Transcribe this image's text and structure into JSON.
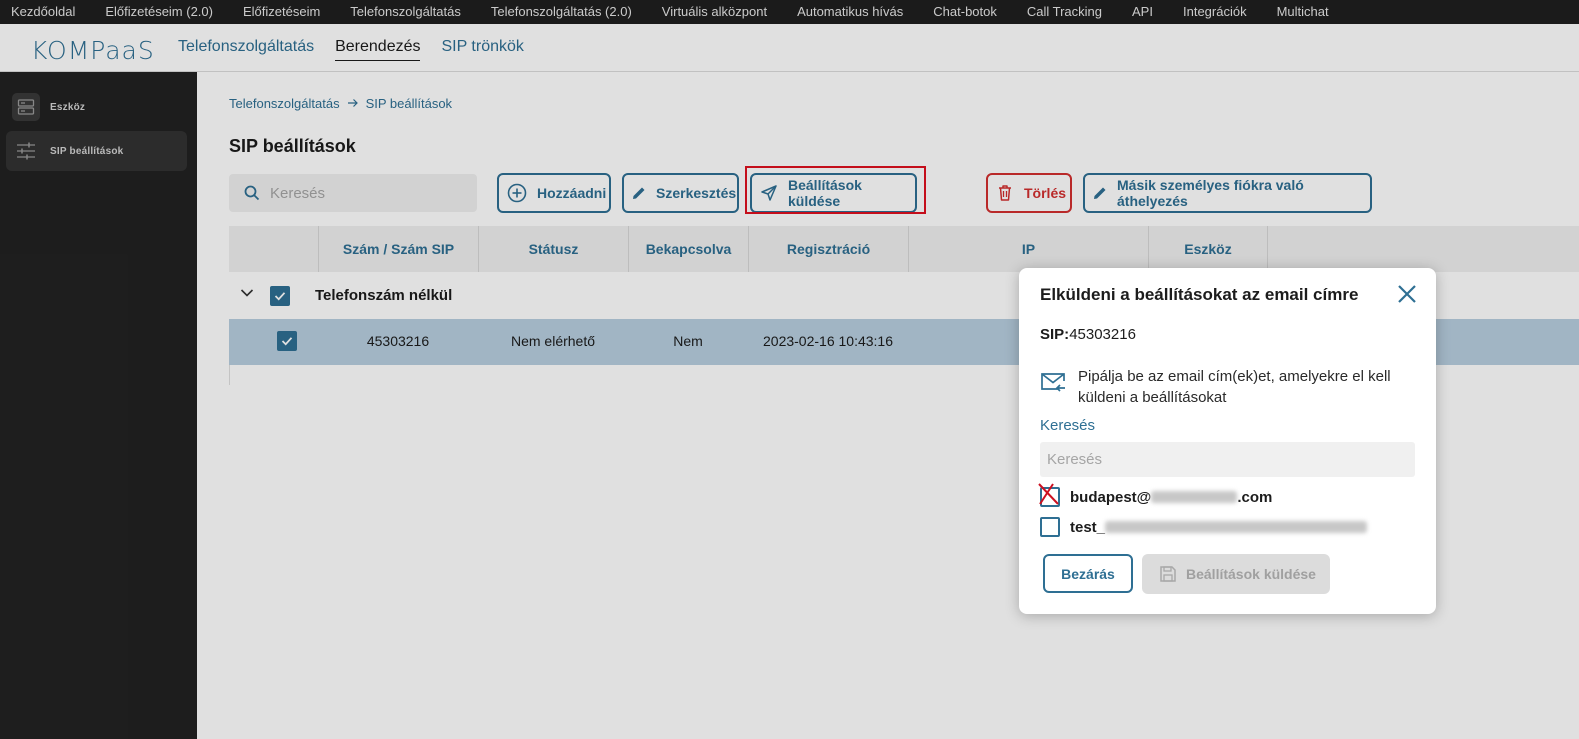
{
  "topnav": [
    "Kezdőoldal",
    "Előfizetéseim (2.0)",
    "Előfizetéseim",
    "Telefonszolgáltatás",
    "Telefonszolgáltatás (2.0)",
    "Virtuális alközpont",
    "Automatikus hívás",
    "Chat-botok",
    "Call Tracking",
    "API",
    "Integrációk",
    "Multichat"
  ],
  "logo": "KOMPaaS",
  "header_tabs": [
    "Telefonszolgáltatás",
    "Berendezés",
    "SIP trönkök"
  ],
  "sidebar": [
    {
      "label": "Eszköz",
      "icon": "server-icon"
    },
    {
      "label": "SIP beállítások",
      "icon": "sliders-icon"
    }
  ],
  "breadcrumb": {
    "parent": "Telefonszolgáltatás",
    "current": "SIP beállítások"
  },
  "page_title": "SIP beállítások",
  "search_placeholder": "Keresés",
  "toolbar": {
    "add": "Hozzáadni",
    "edit": "Szerkesztés",
    "send_settings": "Beállítások küldése",
    "delete": "Törlés",
    "move": "Másik személyes fiókra való áthelyezés"
  },
  "table": {
    "headers": [
      "Szám / Szám SIP",
      "Státusz",
      "Bekapcsolva",
      "Regisztráció",
      "IP",
      "Eszköz"
    ],
    "group_label": "Telefonszám nélkül",
    "rows": [
      {
        "number": "45303216",
        "status": "Nem elérhető",
        "enabled": "Nem",
        "registration": "2023-02-16 10:43:16"
      }
    ]
  },
  "modal": {
    "title": "Elküldeni a beállításokat az email címre",
    "sip_label": "SIP:",
    "sip_value": "45303216",
    "info": "Pipálja be az email cím(ek)et, amelyekre el kell küldeni a beállításokat",
    "search_label": "Keresés",
    "search_placeholder": "Keresés",
    "emails": [
      {
        "prefix": "budapest@",
        "suffix": ".com"
      },
      {
        "prefix": "test_",
        "suffix": ""
      }
    ],
    "close_label": "Bezárás",
    "send_label": "Beállítások küldése"
  },
  "colors": {
    "accent": "#2e6f93",
    "danger": "#d32f2f",
    "highlight": "#e0101f",
    "selected_row": "#b8cfe0"
  }
}
